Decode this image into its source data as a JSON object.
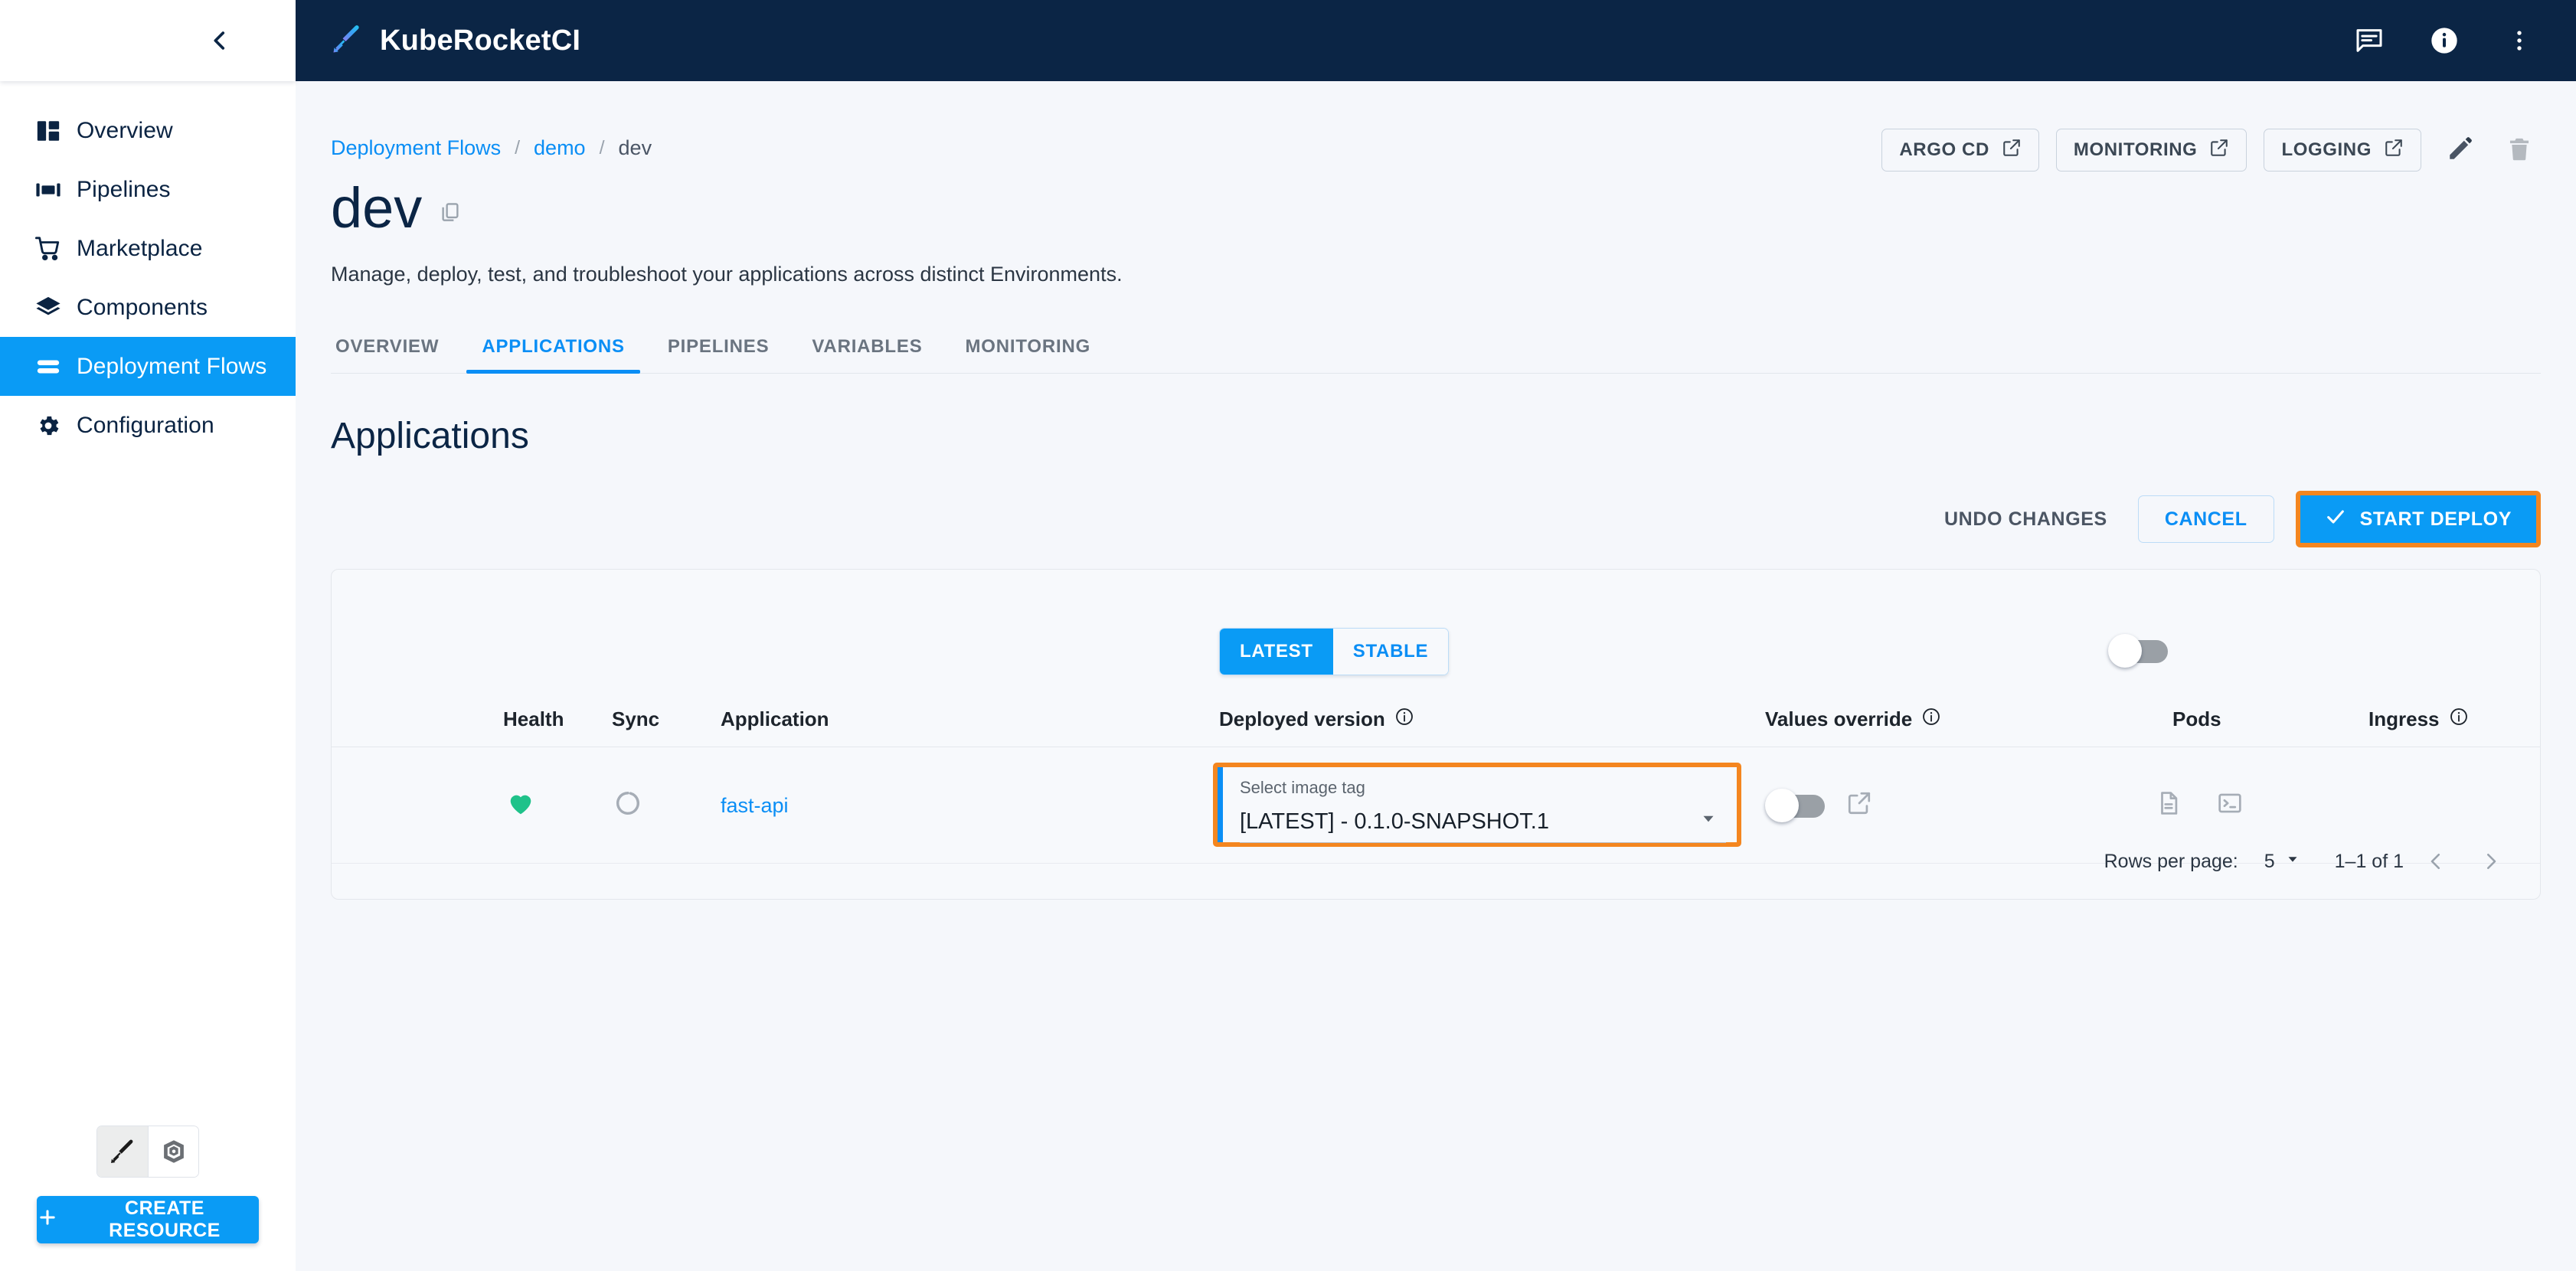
{
  "app": {
    "brand_name": "KubeRocketCI",
    "brand_logo_icon": "rocket-feather-icon"
  },
  "topbar": {
    "icons": [
      {
        "name": "feedback-icon",
        "label": "Feedback"
      },
      {
        "name": "info-icon",
        "label": "Information"
      },
      {
        "name": "more-vertical-icon",
        "label": "More options"
      }
    ]
  },
  "sidebar": {
    "collapse_icon": "chevron-left-icon",
    "items": [
      {
        "label": "Overview",
        "icon": "dashboard-icon",
        "active": false
      },
      {
        "label": "Pipelines",
        "icon": "pipelines-icon",
        "active": false
      },
      {
        "label": "Marketplace",
        "icon": "cart-icon",
        "active": false
      },
      {
        "label": "Components",
        "icon": "layers-icon",
        "active": false
      },
      {
        "label": "Deployment Flows",
        "icon": "flows-icon",
        "active": true
      },
      {
        "label": "Configuration",
        "icon": "gear-icon",
        "active": false
      }
    ],
    "cluster_switch": [
      {
        "name": "krci-logo-icon",
        "selected": true
      },
      {
        "name": "kubernetes-logo-icon",
        "selected": false
      }
    ],
    "create_resource_label": "CREATE RESOURCE",
    "create_resource_icon": "plus-icon"
  },
  "breadcrumb": [
    {
      "label": "Deployment Flows",
      "link": true
    },
    {
      "label": "demo",
      "link": true
    },
    {
      "label": "dev",
      "link": false
    }
  ],
  "page": {
    "title": "dev",
    "copy_icon": "copy-icon",
    "subtitle": "Manage, deploy, test, and troubleshoot your applications across distinct Environments."
  },
  "header_actions": {
    "buttons": [
      {
        "label": "ARGO CD",
        "icon": "external-link-icon"
      },
      {
        "label": "MONITORING",
        "icon": "external-link-icon"
      },
      {
        "label": "LOGGING",
        "icon": "external-link-icon"
      }
    ],
    "edit_icon": "pencil-icon",
    "delete_icon": "trash-icon"
  },
  "tabs": [
    {
      "label": "OVERVIEW",
      "active": false
    },
    {
      "label": "APPLICATIONS",
      "active": true
    },
    {
      "label": "PIPELINES",
      "active": false
    },
    {
      "label": "VARIABLES",
      "active": false
    },
    {
      "label": "MONITORING",
      "active": false
    }
  ],
  "section": {
    "title": "Applications"
  },
  "action_bar": {
    "undo_label": "UNDO CHANGES",
    "cancel_label": "CANCEL",
    "start_deploy_label": "START DEPLOY",
    "start_deploy_icon": "check-icon",
    "highlight_color": "#f4861f"
  },
  "version_toggle": {
    "options": [
      {
        "label": "LATEST",
        "selected": true
      },
      {
        "label": "STABLE",
        "selected": false
      }
    ]
  },
  "values_override_master": {
    "name": "values-override-master-toggle",
    "checked": false
  },
  "table": {
    "columns": [
      {
        "key": "health",
        "label": "Health",
        "info": false
      },
      {
        "key": "sync",
        "label": "Sync",
        "info": false
      },
      {
        "key": "application",
        "label": "Application",
        "info": false
      },
      {
        "key": "deployed_version",
        "label": "Deployed version",
        "info": true
      },
      {
        "key": "values_override",
        "label": "Values override",
        "info": true
      },
      {
        "key": "pods",
        "label": "Pods",
        "info": false
      },
      {
        "key": "ingress",
        "label": "Ingress",
        "info": true
      }
    ],
    "rows": [
      {
        "health_icon": "heart-icon",
        "health_color": "#1fc28a",
        "sync_icon": "sync-circle-icon",
        "application": "fast-api",
        "select_label": "Select image tag",
        "select_value": "[LATEST] - 0.1.0-SNAPSHOT.1",
        "values_override_checked": false,
        "values_override_link_icon": "external-link-icon",
        "pods_log_icon": "document-icon",
        "pods_terminal_icon": "terminal-icon"
      }
    ]
  },
  "pagination": {
    "rows_per_page_label": "Rows per page:",
    "rows_per_page_value": "5",
    "range_label": "1–1 of 1",
    "prev_icon": "chevron-left-icon",
    "next_icon": "chevron-right-icon"
  }
}
